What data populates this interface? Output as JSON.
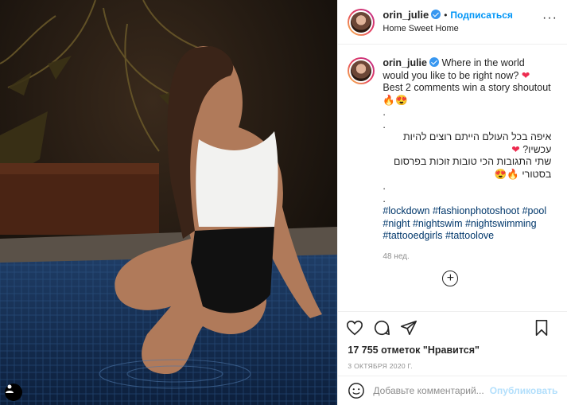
{
  "post": {
    "username": "orin_julie",
    "follow_label": "Подписаться",
    "separator": "•",
    "location": "Home Sweet Home",
    "more_label": "···"
  },
  "caption": {
    "username": "orin_julie",
    "line1": "Where in the world would you like to be right now?",
    "line2": "Best 2 comments win a story shoutout",
    "emoji1": "🔥😍",
    "dot": ".",
    "hebrew1": "איפה בכל העולם הייתם רוצים להיות עכשיו?",
    "hebrew2": "שתי התגובות הכי טובות זוכות בפרסום בסטורי",
    "hashtags": [
      "#lockdown",
      "#fashionphotoshoot",
      "#pool",
      "#night",
      "#nightswim",
      "#nightswimming",
      "#tattooedgirls",
      "#tattoolove"
    ],
    "time_ago": "48 нед."
  },
  "likes": "17 755 отметок \"Нравится\"",
  "date": "3 ОКТЯБРЯ 2020 Г.",
  "comment": {
    "placeholder": "Добавьте комментарий...",
    "publish_label": "Опубликовать"
  },
  "icons": {
    "like": "heart-icon",
    "comment": "comment-icon",
    "share": "share-icon",
    "save": "bookmark-icon",
    "emoji": "smiley-icon",
    "tag": "user-tag-icon",
    "load_more": "plus-circle-icon"
  },
  "colors": {
    "accent": "#0095f6",
    "link": "#00376b",
    "muted": "#8e8e8e",
    "heart": "#ed2b4f"
  }
}
